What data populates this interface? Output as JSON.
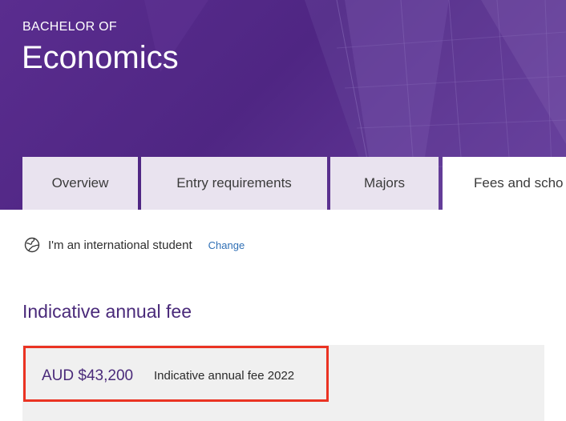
{
  "hero": {
    "subtitle": "BACHELOR OF",
    "title": "Economics"
  },
  "tabs": [
    {
      "label": "Overview",
      "active": false
    },
    {
      "label": "Entry requirements",
      "active": false
    },
    {
      "label": "Majors",
      "active": false
    },
    {
      "label": "Fees and scho",
      "active": true
    }
  ],
  "student": {
    "icon": "globe-icon",
    "label": "I'm an international student",
    "change_label": "Change"
  },
  "fees": {
    "heading": "Indicative annual fee",
    "amount": "AUD $43,200",
    "description": "Indicative annual fee 2022"
  },
  "colors": {
    "brand_purple": "#4f2683",
    "heading_purple": "#4a2a7a",
    "tab_bg": "#e9e3ef",
    "link_blue": "#2f6fb5",
    "highlight_red": "#ea3323",
    "panel_grey": "#f0f0f0"
  }
}
